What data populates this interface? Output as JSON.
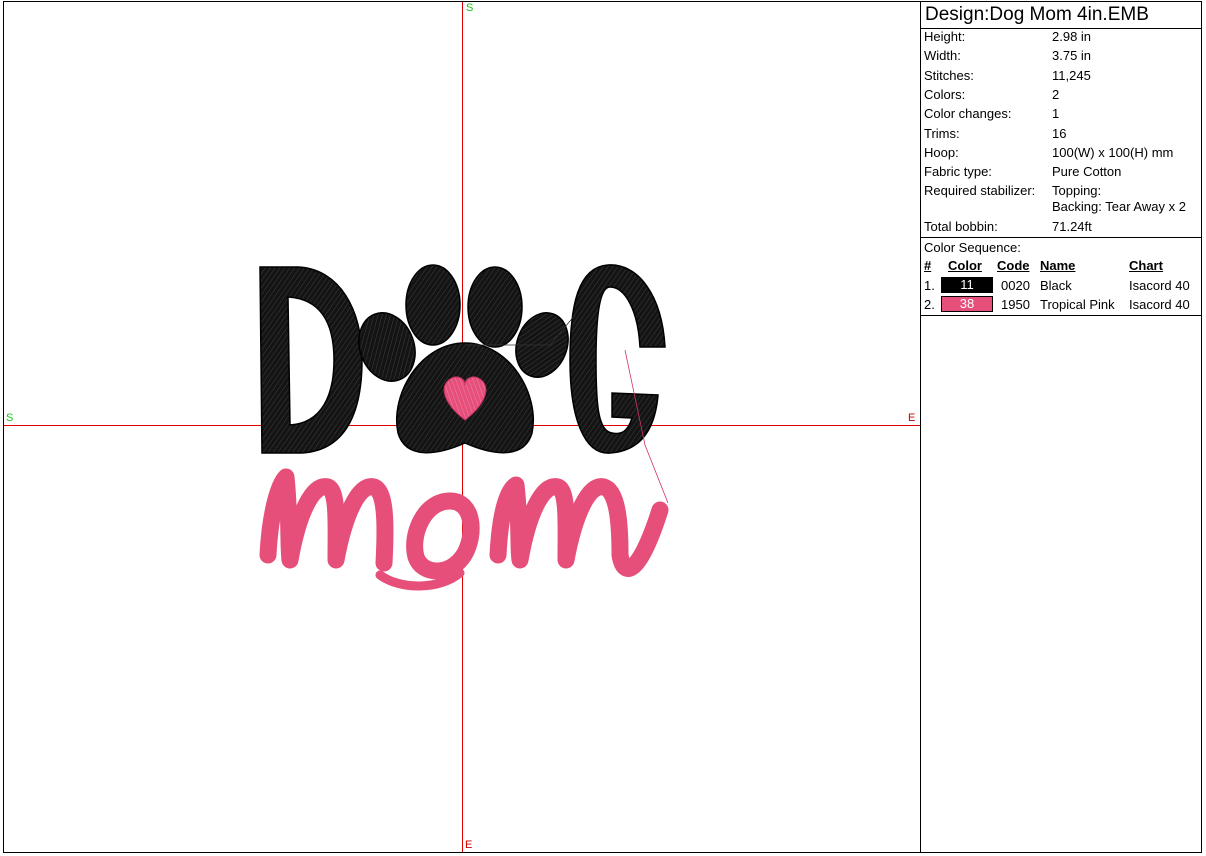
{
  "canvas": {
    "axis_labels": {
      "top": "S",
      "bottom": "E",
      "left": "S",
      "right": "E"
    }
  },
  "panel": {
    "design_title": "Design:Dog Mom 4in.EMB",
    "specs": [
      {
        "label": "Height:",
        "value": "2.98 in"
      },
      {
        "label": "Width:",
        "value": "3.75 in"
      },
      {
        "label": "Stitches:",
        "value": "11,245"
      },
      {
        "label": "Colors:",
        "value": "2"
      },
      {
        "label": "Color changes:",
        "value": "1"
      },
      {
        "label": "Trims:",
        "value": "16"
      },
      {
        "label": "Hoop:",
        "value": "100(W) x 100(H) mm"
      },
      {
        "label": "Fabric type:",
        "value": "Pure Cotton"
      },
      {
        "label": "Required stabilizer:",
        "value": "Topping:",
        "value2": "Backing: Tear Away x 2"
      },
      {
        "label": "Total bobbin:",
        "value": "71.24ft"
      }
    ],
    "color_sequence": {
      "title": "Color Sequence:",
      "headers": {
        "num": "#",
        "color": "Color",
        "code": "Code",
        "name": "Name",
        "chart": "Chart"
      },
      "rows": [
        {
          "num": "1.",
          "swatch_label": "11",
          "swatch_color": "#000000",
          "code": "0020",
          "name": "Black",
          "chart": "Isacord 40"
        },
        {
          "num": "2.",
          "swatch_label": "38",
          "swatch_color": "#e64f7a",
          "code": "1950",
          "name": "Tropical Pink",
          "chart": "Isacord 40"
        }
      ]
    }
  }
}
